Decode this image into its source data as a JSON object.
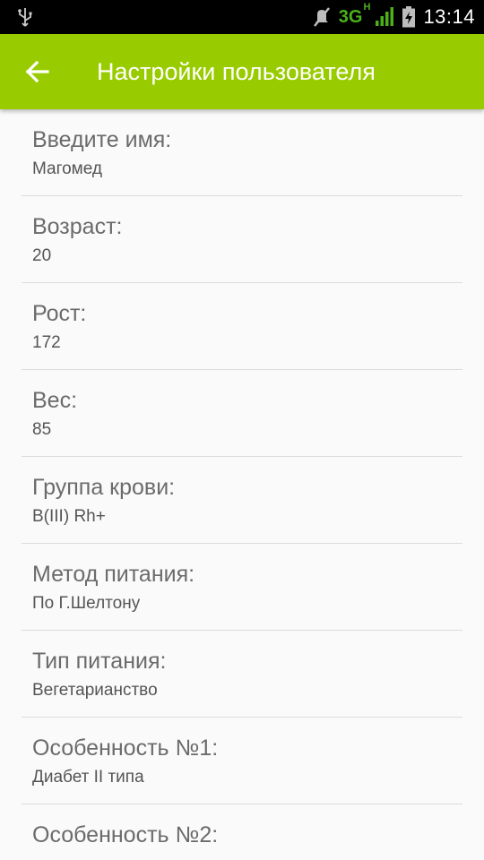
{
  "status_bar": {
    "network": "3G",
    "network_sub": "H",
    "time": "13:14"
  },
  "toolbar": {
    "title": "Настройки пользователя"
  },
  "settings": [
    {
      "label": "Введите имя:",
      "value": "Магомед"
    },
    {
      "label": "Возраст:",
      "value": "20"
    },
    {
      "label": "Рост:",
      "value": "172"
    },
    {
      "label": "Вес:",
      "value": "85"
    },
    {
      "label": "Группа крови:",
      "value": "B(III) Rh+"
    },
    {
      "label": "Метод питания:",
      "value": "По Г.Шелтону"
    },
    {
      "label": "Тип питания:",
      "value": "Вегетарианство"
    },
    {
      "label": "Особенность №1:",
      "value": "Диабет II типа"
    },
    {
      "label": "Особенность №2:",
      "value": ""
    }
  ]
}
